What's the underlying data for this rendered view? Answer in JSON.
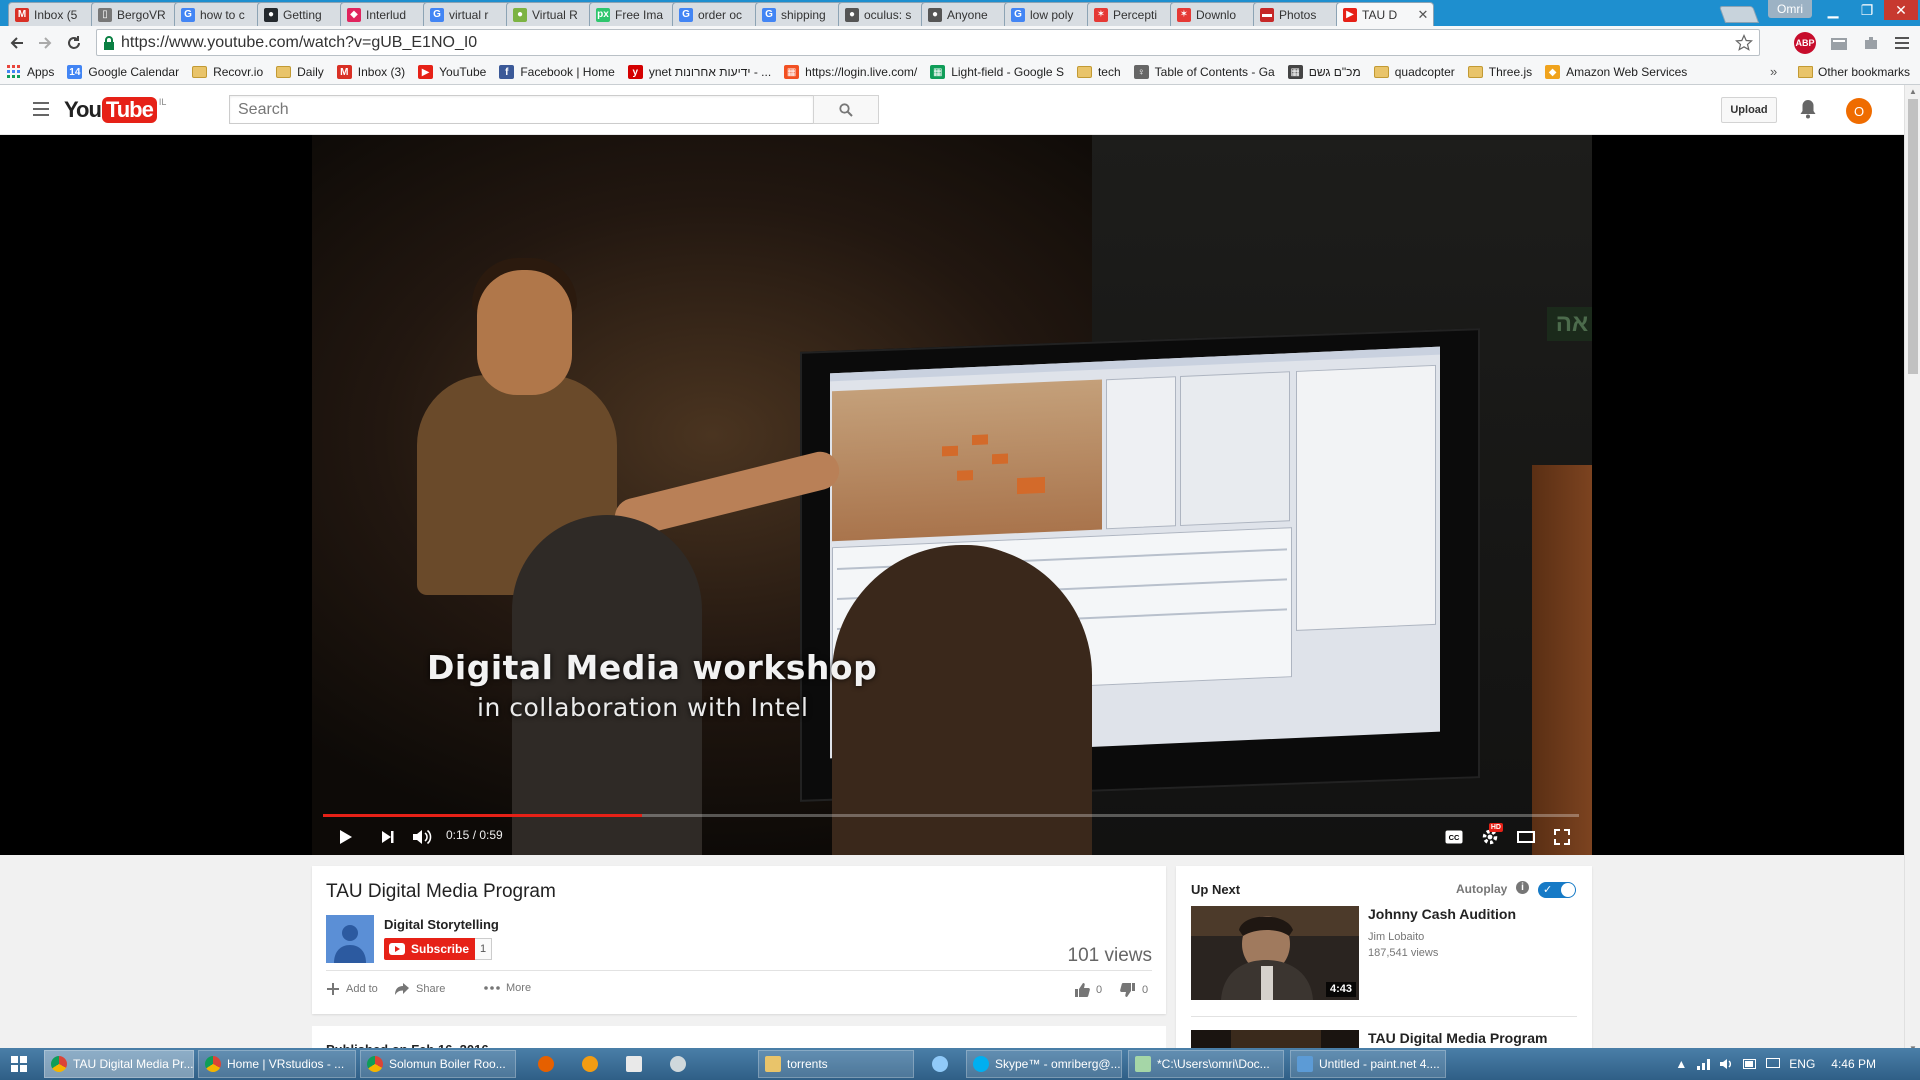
{
  "browser": {
    "tabs": [
      {
        "label": "Inbox (5",
        "icon": "gmail-icon",
        "color": "#d93025",
        "glyph": "M"
      },
      {
        "label": "BergoVR",
        "icon": "document-icon",
        "color": "#777777",
        "glyph": "▯"
      },
      {
        "label": "how to c",
        "icon": "google-icon",
        "color": "#4285f4",
        "glyph": "G"
      },
      {
        "label": "Getting",
        "icon": "github-icon",
        "color": "#24292e",
        "glyph": "●"
      },
      {
        "label": "Interlud",
        "icon": "bookmark-icon",
        "color": "#e0245e",
        "glyph": "◆"
      },
      {
        "label": "virtual r",
        "icon": "google-icon",
        "color": "#4285f4",
        "glyph": "G"
      },
      {
        "label": "Virtual R",
        "icon": "leaf-icon",
        "color": "#7cb342",
        "glyph": "●"
      },
      {
        "label": "Free Ima",
        "icon": "pixabay-icon",
        "color": "#2ec66d",
        "glyph": "px"
      },
      {
        "label": "order oc",
        "icon": "google-icon",
        "color": "#4285f4",
        "glyph": "G"
      },
      {
        "label": "shipping",
        "icon": "google-icon",
        "color": "#4285f4",
        "glyph": "G"
      },
      {
        "label": "oculus: s",
        "icon": "reddit-icon",
        "color": "#555555",
        "glyph": "●"
      },
      {
        "label": "Anyone",
        "icon": "reddit-icon",
        "color": "#555555",
        "glyph": "●"
      },
      {
        "label": "low poly",
        "icon": "google-icon",
        "color": "#4285f4",
        "glyph": "G"
      },
      {
        "label": "Percepti",
        "icon": "photo-icon",
        "color": "#e53935",
        "glyph": "✶"
      },
      {
        "label": "Downlo",
        "icon": "photo-icon",
        "color": "#e53935",
        "glyph": "✶"
      },
      {
        "label": "Photos",
        "icon": "gmail-icon",
        "color": "#c62828",
        "glyph": "▬"
      },
      {
        "label": "TAU D",
        "icon": "youtube-icon",
        "color": "#e62117",
        "glyph": "▶",
        "active": true
      }
    ],
    "tab_close_glyph": "✕",
    "profile_name": "Omri",
    "window_controls": {
      "minimize": "▁",
      "restore": "❐",
      "close": "✕"
    },
    "url": "https://www.youtube.com/watch?v=gUB_E1NO_I0",
    "bookmarks": [
      {
        "label": "Apps",
        "icon": "apps-grid-icon"
      },
      {
        "label": "Google Calendar",
        "icon": "calendar-icon",
        "glyph": "14",
        "color": "#4285f4"
      },
      {
        "label": "Recovr.io",
        "icon": "folder-icon"
      },
      {
        "label": "Daily",
        "icon": "folder-icon"
      },
      {
        "label": "Inbox (3)",
        "icon": "gmail-icon",
        "glyph": "M",
        "color": "#d93025"
      },
      {
        "label": "YouTube",
        "icon": "youtube-icon",
        "glyph": "▶",
        "color": "#e62117"
      },
      {
        "label": "Facebook | Home",
        "icon": "facebook-icon",
        "glyph": "f",
        "color": "#3b5998"
      },
      {
        "label": "ynet ידיעות אחרונות - ...",
        "icon": "ynet-icon",
        "glyph": "y",
        "color": "#d40000"
      },
      {
        "label": "https://login.live.com/",
        "icon": "windows-icon",
        "glyph": "▦",
        "color": "#f25022"
      },
      {
        "label": "Light-field - Google S",
        "icon": "sheets-icon",
        "glyph": "▦",
        "color": "#0f9d58"
      },
      {
        "label": "tech",
        "icon": "folder-icon"
      },
      {
        "label": "Table of Contents - Ga",
        "icon": "bulb-icon",
        "glyph": "♀",
        "color": "#666666"
      },
      {
        "label": "מכ\"ם גשם",
        "icon": "weather-icon",
        "glyph": "▦",
        "color": "#444444"
      },
      {
        "label": "quadcopter",
        "icon": "folder-icon"
      },
      {
        "label": "Three.js",
        "icon": "folder-icon"
      },
      {
        "label": "Amazon Web Services",
        "icon": "aws-icon",
        "glyph": "◆",
        "color": "#f0a31d"
      }
    ],
    "bookmarks_more": "»",
    "other_bookmarks": "Other bookmarks",
    "extensions": [
      {
        "name": "adblock-icon",
        "glyph": "ABP",
        "color": "#c70d2c"
      },
      {
        "name": "extension-icon",
        "glyph": "◫",
        "color": "#8a8a8a"
      },
      {
        "name": "extension-icon",
        "glyph": "⚙",
        "color": "#8a8a8a"
      }
    ]
  },
  "youtube": {
    "logo_you": "You",
    "logo_tube": "Tube",
    "country": "IL",
    "search_placeholder": "Search",
    "upload_label": "Upload",
    "avatar_letter": "O"
  },
  "player": {
    "overlay_title": "Digital Media workshop",
    "overlay_subtitle": "in collaboration with Intel",
    "time_display": "0:15 / 0:59",
    "progress_fraction": 0.254,
    "buffer_fraction": 0.254,
    "exit_sign": "אה",
    "hd_badge": "HD",
    "cc_label": "CC"
  },
  "video": {
    "title": "TAU Digital Media Program",
    "channel": "Digital Storytelling",
    "subscribe_label": "Subscribe",
    "subscriber_count": "1",
    "views": "101 views",
    "actions": {
      "add_to": "Add to",
      "share": "Share",
      "more": "More"
    },
    "likes": "0",
    "dislikes": "0",
    "published": "Published on Feb 16, 2016"
  },
  "up_next": {
    "heading": "Up Next",
    "autoplay_label": "Autoplay",
    "autoplay_info": "i",
    "autoplay_on": true,
    "items": [
      {
        "title": "Johnny Cash Audition",
        "channel": "Jim Lobaito",
        "views": "187,541 views",
        "duration": "4:43"
      },
      {
        "title": "TAU Digital Media Program",
        "channel": "",
        "views": "",
        "duration": ""
      }
    ]
  },
  "taskbar": {
    "items": [
      {
        "label": "TAU Digital Media Pr...",
        "icon": "chrome-icon",
        "active": true
      },
      {
        "label": "Home | VRstudios - ...",
        "icon": "chrome-icon"
      },
      {
        "label": "Solomun Boiler Roo...",
        "icon": "chrome-icon"
      },
      {
        "label": "",
        "icon": "firefox-icon",
        "pinned": true
      },
      {
        "label": "",
        "icon": "media-player-icon",
        "pinned": true
      },
      {
        "label": "",
        "icon": "calculator-icon",
        "pinned": true
      },
      {
        "label": "",
        "icon": "audio-icon",
        "pinned": true
      },
      {
        "label": "torrents",
        "icon": "folder-icon"
      },
      {
        "label": "",
        "icon": "network-icon",
        "pinned": true
      },
      {
        "label": "Skype™ - omriberg@...",
        "icon": "skype-icon"
      },
      {
        "label": "*C:\\Users\\omri\\Doc...",
        "icon": "notepad-icon"
      },
      {
        "label": "Untitled - paint.net 4....",
        "icon": "paintnet-icon"
      }
    ],
    "language": "ENG",
    "clock": "4:46 PM"
  },
  "colors": {
    "youtube_red": "#e62117",
    "autoplay_blue": "#167ac6",
    "chrome_frame": "#1e8fcf",
    "taskbar": "#2f5f86"
  }
}
